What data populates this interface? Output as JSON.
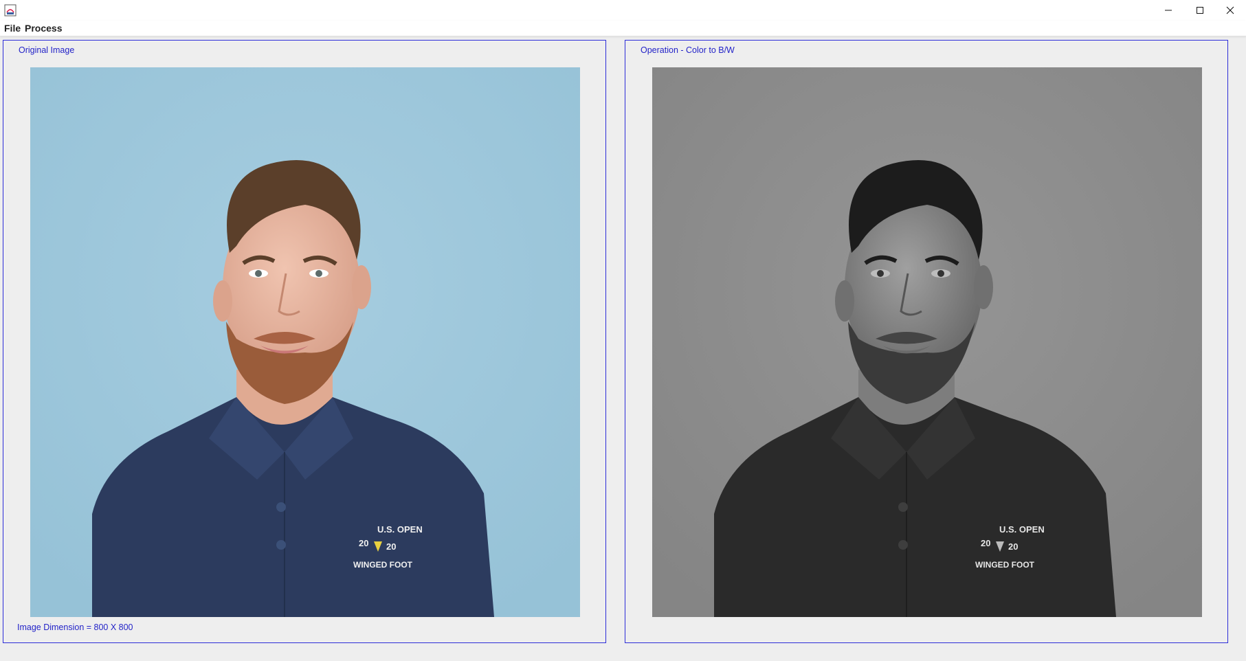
{
  "window": {
    "controls": {
      "minimize": "minimize-icon",
      "maximize": "maximize-icon",
      "close": "close-icon"
    }
  },
  "menu": {
    "items": [
      {
        "label": "File"
      },
      {
        "label": "Process"
      }
    ]
  },
  "left_panel": {
    "title": "Original Image",
    "dimension_label": "Image Dimension = 800 X 800",
    "image_logo": {
      "line1": "U.S. OPEN",
      "left_num": "20",
      "right_num": "20",
      "line2": "WINGED FOOT"
    }
  },
  "right_panel": {
    "title": "Operation - Color to B/W",
    "image_logo": {
      "line1": "U.S. OPEN",
      "left_num": "20",
      "right_num": "20",
      "line2": "WINGED FOOT"
    }
  },
  "colors": {
    "border": "#2b2bd8",
    "label_text": "#2323c8",
    "original_background": "#9ec6da",
    "bw_background": "#8a8a8a",
    "shirt_color": "#2c3b5e"
  }
}
